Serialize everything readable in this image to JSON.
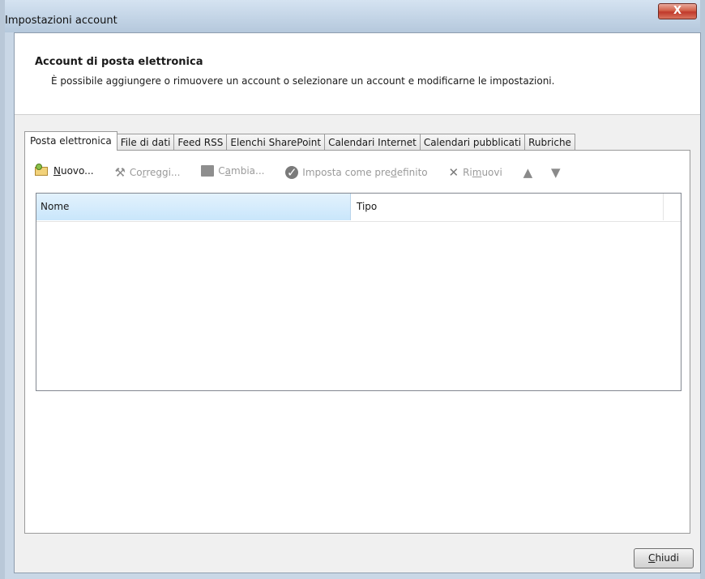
{
  "window": {
    "title": "Impostazioni account",
    "close_glyph": "X"
  },
  "header": {
    "title": "Account di posta elettronica",
    "description": "È possibile aggiungere o rimuovere un account o selezionare un account e modificarne le impostazioni."
  },
  "tabs": [
    {
      "label": "Posta elettronica",
      "active": true
    },
    {
      "label": "File di dati"
    },
    {
      "label": "Feed RSS"
    },
    {
      "label": "Elenchi SharePoint"
    },
    {
      "label": "Calendari Internet"
    },
    {
      "label": "Calendari pubblicati"
    },
    {
      "label": "Rubriche"
    }
  ],
  "toolbar": {
    "new_a": "",
    "new_u": "N",
    "new_b": "uovo...",
    "repair_a": "Co",
    "repair_u": "r",
    "repair_b": "reggi...",
    "change_a": "C",
    "change_u": "a",
    "change_b": "mbia...",
    "default_a": "Imposta come pre",
    "default_u": "d",
    "default_b": "efinito",
    "remove_a": "Ri",
    "remove_u": "m",
    "remove_b": "uovi",
    "icons": {
      "new": "new-mail-icon",
      "repair": "tools-icon",
      "change": "change-icon",
      "default": "checkmark-icon",
      "remove": "remove-x-icon",
      "up": "arrow-up-icon",
      "down": "arrow-down-icon"
    }
  },
  "grid": {
    "columns": [
      "Nome",
      "Tipo"
    ],
    "rows": []
  },
  "footer": {
    "close_u": "C",
    "close_b": "hiudi"
  },
  "colors": {
    "frame": "#c9d7e6",
    "client": "#f0f0f0",
    "header_sel": "#c9e6fb",
    "close_red": "#c0392b"
  }
}
